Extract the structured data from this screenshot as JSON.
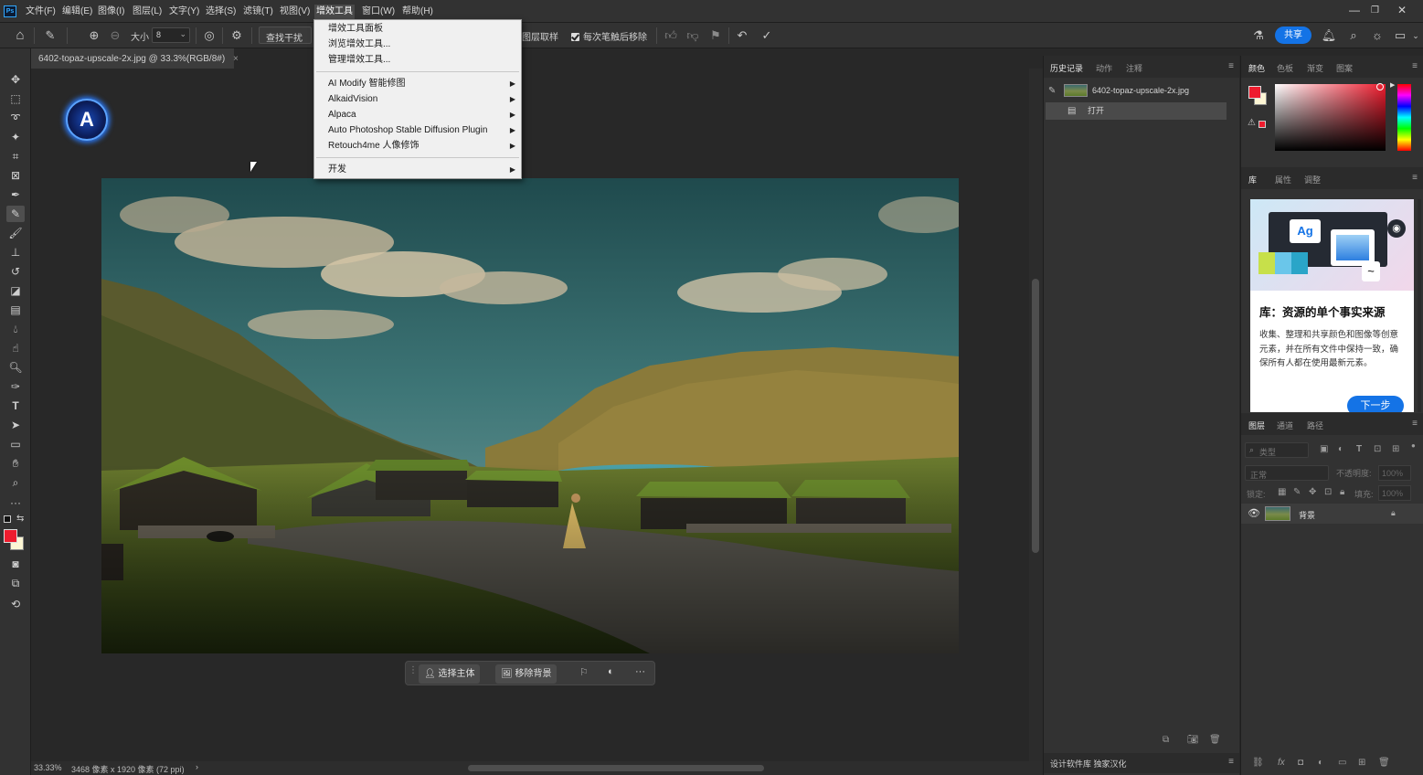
{
  "menubar": {
    "logo": "Ps",
    "items": [
      "文件(F)",
      "编辑(E)",
      "图像(I)",
      "图层(L)",
      "文字(Y)",
      "选择(S)",
      "滤镜(T)",
      "视图(V)",
      "增效工具",
      "窗口(W)",
      "帮助(H)"
    ],
    "window_controls": [
      "—",
      "❐",
      "✕"
    ]
  },
  "optionsbar": {
    "size_label": "大小",
    "size_value": "8",
    "find_interference": "查找干扰",
    "sample_all_layers": "图层取样",
    "remove_after_stroke": "每次笔触后移除",
    "share_label": "共享"
  },
  "document": {
    "tab_title": "6402-topaz-upscale-2x.jpg @ 33.3%(RGB/8#)",
    "tab_close": "×",
    "status_zoom": "33.33%",
    "status_info": "3468 像素 x 1920 像素 (72 ppi)",
    "status_arrow": "›"
  },
  "dropdown": {
    "items": [
      {
        "label": "增效工具面板",
        "submenu": false
      },
      {
        "label": "浏览增效工具...",
        "submenu": false
      },
      {
        "label": "管理增效工具...",
        "submenu": false
      },
      {
        "label": "AI Modify 智能修图",
        "submenu": true
      },
      {
        "label": "AlkaidVision",
        "submenu": true
      },
      {
        "label": "Alpaca",
        "submenu": true
      },
      {
        "label": "Auto Photoshop Stable Diffusion Plugin",
        "submenu": true
      },
      {
        "label": "Retouch4me 人像修饰",
        "submenu": true
      },
      {
        "label": "开发",
        "submenu": true
      }
    ]
  },
  "context_bar": {
    "select_subject": "选择主体",
    "remove_background": "移除背景",
    "more": "···"
  },
  "history_panel": {
    "tabs": [
      "历史记录",
      "动作",
      "注释"
    ],
    "snapshot": "6402-topaz-upscale-2x.jpg",
    "step": "打开",
    "footer": "设计软件库 独家汉化"
  },
  "color_panel": {
    "tabs": [
      "颜色",
      "色板",
      "渐变",
      "图案"
    ],
    "foreground": "#ee1c2e",
    "background": "#fdf6d4"
  },
  "library_panel": {
    "tabs": [
      "库",
      "属性",
      "调整"
    ],
    "card_title": "库：资源的单个事实来源",
    "card_desc": "收集、整理和共享颜色和图像等创意元素，并在所有文件中保持一致，确保所有人都在使用最新元素。",
    "next": "下一步",
    "icon_text": "Ag"
  },
  "layers_panel": {
    "tabs": [
      "图层",
      "通道",
      "路径"
    ],
    "filter_placeholder": "类型",
    "blend_mode": "正常",
    "opacity_label": "不透明度:",
    "opacity_value": "100%",
    "lock_label": "锁定:",
    "fill_label": "填充:",
    "fill_value": "100%",
    "layer_name": "背景"
  }
}
